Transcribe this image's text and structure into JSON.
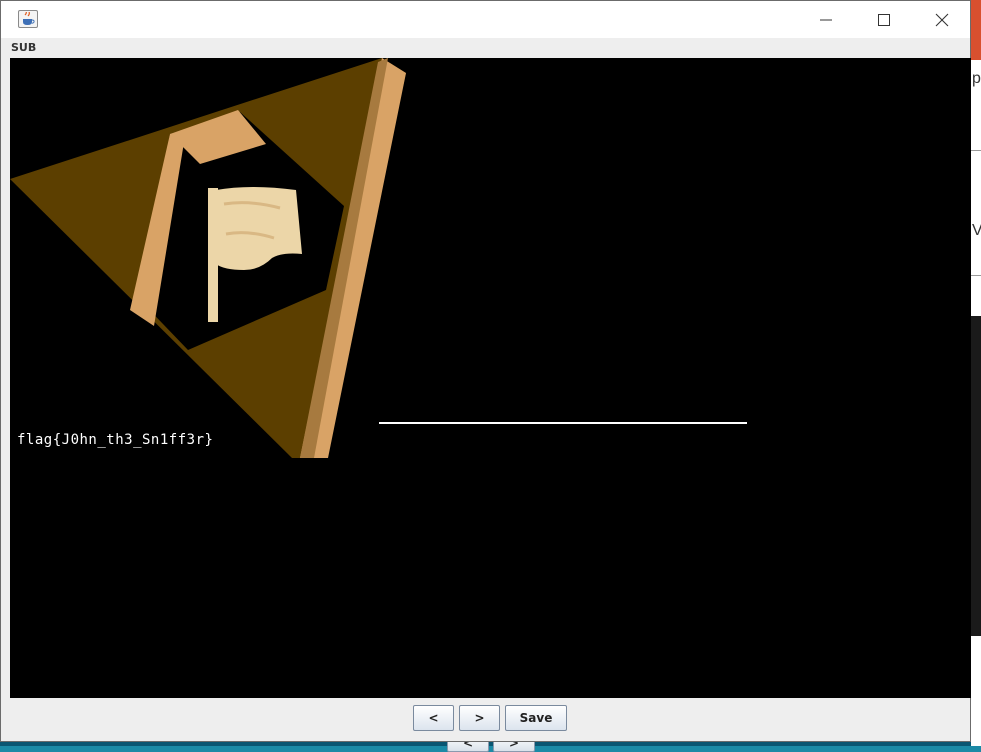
{
  "menu": {
    "sub_label": "SUB"
  },
  "image": {
    "flag_text": "flag{J0hn_th3_Sn1ff3r}",
    "colors": {
      "dark_brown": "#5c3f00",
      "light_tan": "#d9a366",
      "flag_cream": "#ecd6a8"
    }
  },
  "controls": {
    "prev_label": "<",
    "next_label": ">",
    "save_label": "Save"
  },
  "background": {
    "ghost_prev": "<",
    "ghost_next": ">",
    "right_edge_letters": [
      "p",
      "V"
    ]
  },
  "icons": {
    "app": "java-app-icon",
    "minimize": "minimize-icon",
    "maximize": "maximize-icon",
    "close": "close-icon"
  }
}
